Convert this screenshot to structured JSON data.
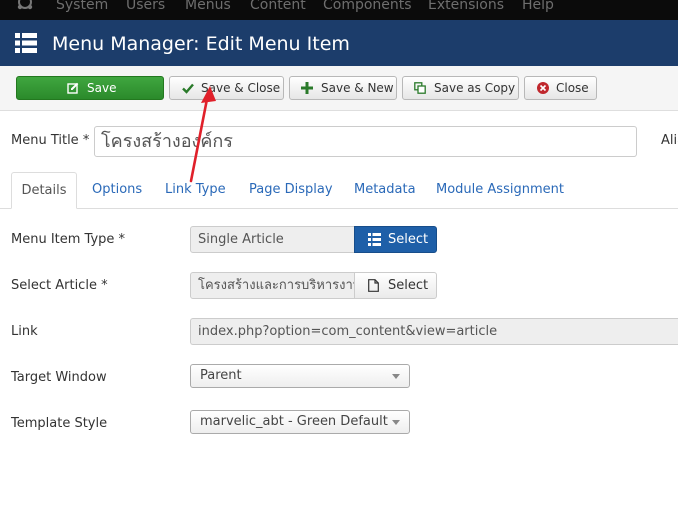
{
  "topnav": {
    "items": [
      "System",
      "Users",
      "Menus",
      "Content",
      "Components",
      "Extensions",
      "Help"
    ]
  },
  "header": {
    "title": "Menu Manager: Edit Menu Item",
    "background": "#1c3d6b"
  },
  "toolbar": {
    "save": "Save",
    "save_close": "Save & Close",
    "save_new": "Save & New",
    "save_copy": "Save as Copy",
    "close": "Close",
    "save_color": "#2f962f"
  },
  "form": {
    "menu_title_label": "Menu Title *",
    "menu_title_value": "โครงสร้างองค์กร",
    "alias_label": "Alia"
  },
  "tabs": [
    "Details",
    "Options",
    "Link Type",
    "Page Display",
    "Metadata",
    "Module Assignment"
  ],
  "fields": {
    "item_type_label": "Menu Item Type *",
    "item_type_value": "Single Article",
    "item_type_button": "Select",
    "article_label": "Select Article *",
    "article_value": "โครงสร้างและการบริหารงาน",
    "article_button": "Select",
    "link_label": "Link",
    "link_value": "index.php?option=com_content&view=article",
    "target_label": "Target Window",
    "target_value": "Parent",
    "template_label": "Template Style",
    "template_value": "marvelic_abt - Green Default"
  },
  "annotation": {
    "arrow_color": "#e0202a"
  }
}
